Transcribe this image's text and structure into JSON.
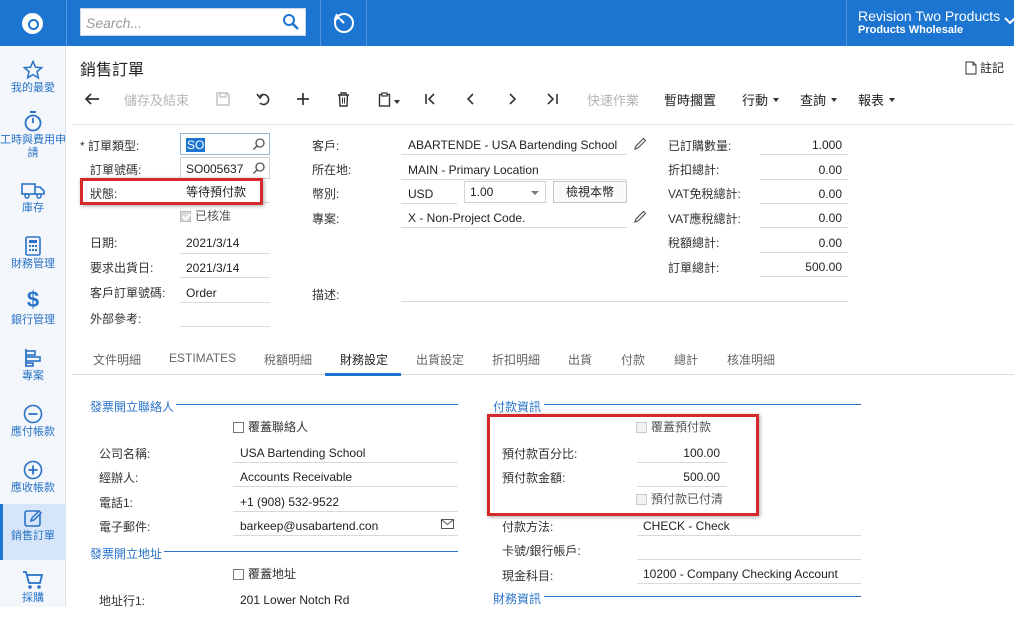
{
  "topbar": {
    "search_placeholder": "Search...",
    "company_name": "Revision Two Products",
    "company_branch": "Products Wholesale",
    "icons": [
      "app-logo-icon",
      "search-icon",
      "history-icon",
      "chevron-down-icon"
    ]
  },
  "sidebar": {
    "items": [
      {
        "label": "我的最愛",
        "icon": "star-icon"
      },
      {
        "label": "工時與費用申請",
        "icon": "stopwatch-icon"
      },
      {
        "label": "庫存",
        "icon": "truck-icon"
      },
      {
        "label": "財務管理",
        "icon": "calculator-icon"
      },
      {
        "label": "銀行管理",
        "icon": "dollar-icon"
      },
      {
        "label": "專案",
        "icon": "project-icon"
      },
      {
        "label": "應付帳款",
        "icon": "minus-circle-icon"
      },
      {
        "label": "應收帳款",
        "icon": "plus-circle-icon"
      },
      {
        "label": "銷售訂單",
        "icon": "edit-icon",
        "active": true
      },
      {
        "label": "採購",
        "icon": "cart-icon"
      }
    ]
  },
  "page": {
    "title": "銷售訂單",
    "notes_label": "註記"
  },
  "toolbar": {
    "save_close": "儲存及結束",
    "quick_process": "快速作業",
    "hold": "暫時擱置",
    "actions": "行動",
    "inquiries": "查詢",
    "reports": "報表"
  },
  "summary": {
    "order_type_label": "訂單類型:",
    "order_type_value": "SO",
    "order_nbr_label": "訂單號碼:",
    "order_nbr_value": "SO005637",
    "status_label": "狀態:",
    "status_value": "等待預付款",
    "approved_label": "已核准",
    "date_label": "日期:",
    "date_value": "2021/3/14",
    "requested_label": "要求出貨日:",
    "requested_value": "2021/3/14",
    "cust_order_label": "客戶訂單號碼:",
    "cust_order_value": "Order",
    "ext_ref_label": "外部參考:",
    "customer_label": "客戶:",
    "customer_value": "ABARTENDE - USA Bartending School",
    "location_label": "所在地:",
    "location_value": "MAIN - Primary Location",
    "currency_label": "幣別:",
    "currency_value": "USD",
    "rate_value": "1.00",
    "view_base_label": "檢視本幣",
    "project_label": "專案:",
    "project_value": "X - Non-Project Code.",
    "description_label": "描述:",
    "ordered_qty_label": "已訂購數量:",
    "ordered_qty_value": "1.000",
    "discount_total_label": "折扣總計:",
    "discount_total_value": "0.00",
    "vat_exempt_label": "VAT免稅總計:",
    "vat_exempt_value": "0.00",
    "vat_taxable_label": "VAT應稅總計:",
    "vat_taxable_value": "0.00",
    "tax_total_label": "稅額總計:",
    "tax_total_value": "0.00",
    "order_total_label": "訂單總計:",
    "order_total_value": "500.00"
  },
  "tabs": [
    "文件明細",
    "ESTIMATES",
    "稅額明細",
    "財務設定",
    "出貨設定",
    "折扣明細",
    "出貨",
    "付款",
    "總計",
    "核准明細"
  ],
  "financial": {
    "bill_contact_title": "發票開立聯絡人",
    "override_contact_label": "覆蓋聯絡人",
    "company_name_label": "公司名稱:",
    "company_name_value": "USA Bartending School",
    "attention_label": "經辦人:",
    "attention_value": "Accounts Receivable",
    "phone_label": "電話1:",
    "phone_value": "+1 (908) 532-9522",
    "email_label": "電子郵件:",
    "email_value": "barkeep@usabartend.con",
    "bill_address_title": "發票開立地址",
    "override_address_label": "覆蓋地址",
    "address1_label": "地址行1:",
    "address1_value": "201 Lower Notch Rd",
    "payment_info_title": "付款資訊",
    "override_prepay_label": "覆蓋預付款",
    "prepay_percent_label": "預付款百分比:",
    "prepay_percent_value": "100.00",
    "prepay_amount_label": "預付款金額:",
    "prepay_amount_value": "500.00",
    "prepay_paid_label": "預付款已付清",
    "payment_method_label": "付款方法:",
    "payment_method_value": "CHECK - Check",
    "card_account_label": "卡號/銀行帳戶:",
    "cash_account_label": "現金科目:",
    "cash_account_value": "10200 - Company Checking Account",
    "financial_info_title": "財務資訊"
  },
  "colors": {
    "brand": "#1b75d1",
    "highlight_box": "#d42a2a"
  }
}
